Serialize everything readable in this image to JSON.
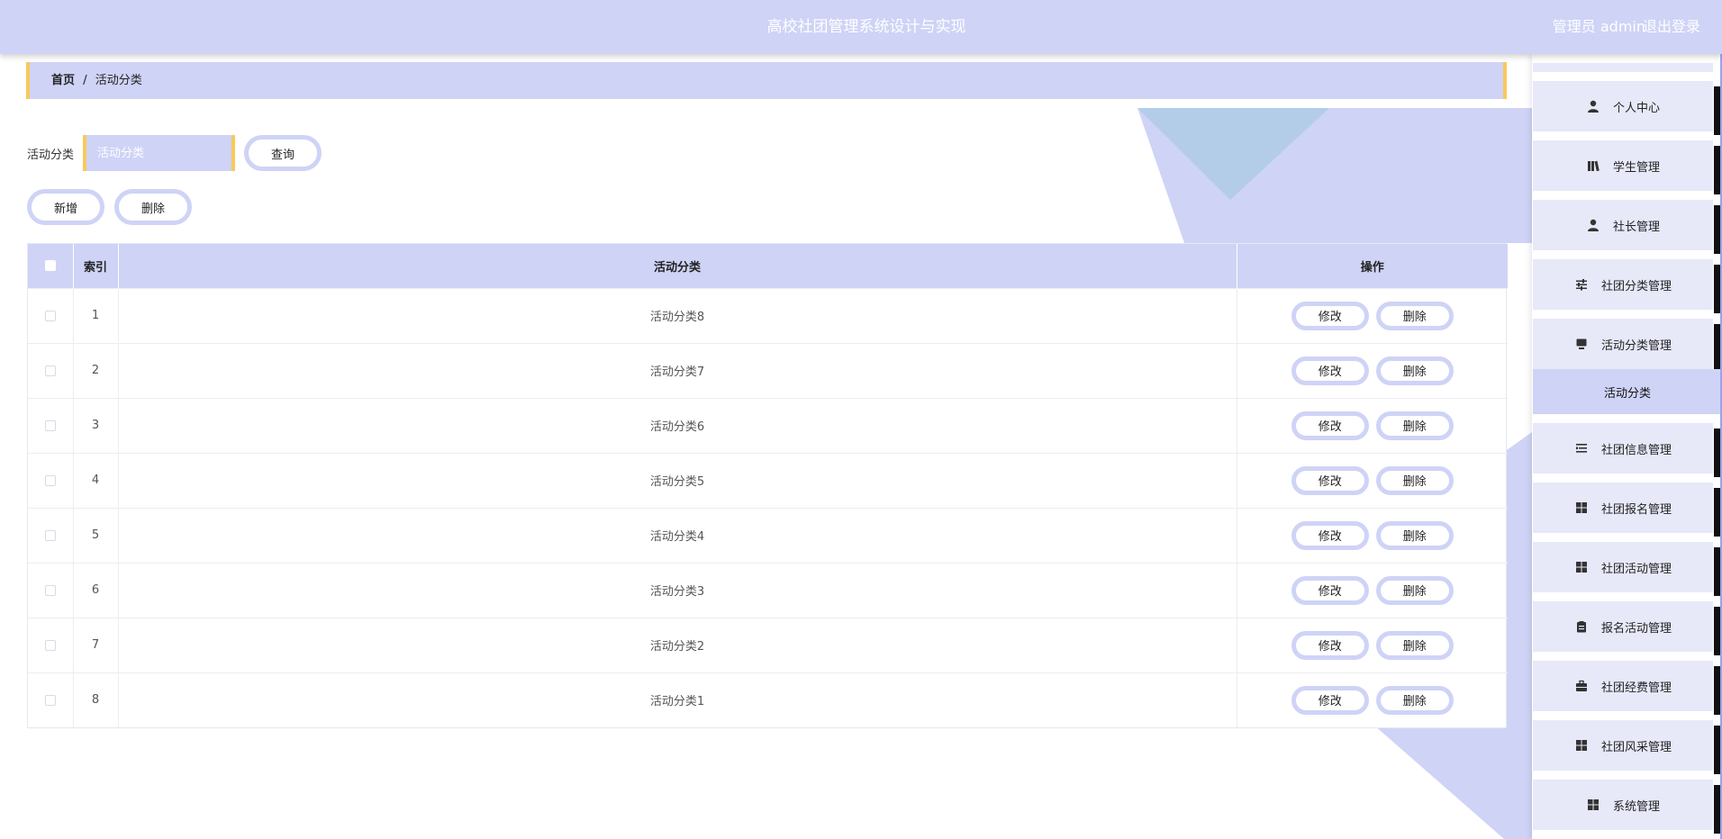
{
  "header": {
    "title": "高校社团管理系统设计与实现",
    "user": "管理员 admin",
    "logout": "退出登录"
  },
  "breadcrumb": {
    "home": "首页",
    "separator": "/",
    "current": "活动分类"
  },
  "search": {
    "label": "活动分类",
    "placeholder": "活动分类",
    "query_button": "查询"
  },
  "actions": {
    "add": "新增",
    "delete": "删除"
  },
  "table": {
    "columns": [
      "索引",
      "活动分类",
      "操作"
    ],
    "edit_label": "修改",
    "delete_label": "删除",
    "rows": [
      {
        "index": "1",
        "name": "活动分类8"
      },
      {
        "index": "2",
        "name": "活动分类7"
      },
      {
        "index": "3",
        "name": "活动分类6"
      },
      {
        "index": "4",
        "name": "活动分类5"
      },
      {
        "index": "5",
        "name": "活动分类4"
      },
      {
        "index": "6",
        "name": "活动分类3"
      },
      {
        "index": "7",
        "name": "活动分类2"
      },
      {
        "index": "8",
        "name": "活动分类1"
      }
    ]
  },
  "sidebar": {
    "items": [
      {
        "label": "个人中心",
        "icon": "user-icon"
      },
      {
        "label": "学生管理",
        "icon": "book-icon"
      },
      {
        "label": "社长管理",
        "icon": "user-icon"
      },
      {
        "label": "社团分类管理",
        "icon": "sliders-icon"
      },
      {
        "label": "活动分类管理",
        "icon": "monitor-icon"
      },
      {
        "label": "社团信息管理",
        "icon": "list-icon"
      },
      {
        "label": "社团报名管理",
        "icon": "grid-icon"
      },
      {
        "label": "社团活动管理",
        "icon": "grid-icon"
      },
      {
        "label": "报名活动管理",
        "icon": "clipboard-icon"
      },
      {
        "label": "社团经费管理",
        "icon": "briefcase-icon"
      },
      {
        "label": "社团风采管理",
        "icon": "grid-icon"
      },
      {
        "label": "系统管理",
        "icon": "grid-icon"
      }
    ],
    "active_sub": "活动分类"
  },
  "colors": {
    "primary": "#cfd3f6",
    "accent": "#f8c95d",
    "deco_blue": "#b3cde8"
  }
}
